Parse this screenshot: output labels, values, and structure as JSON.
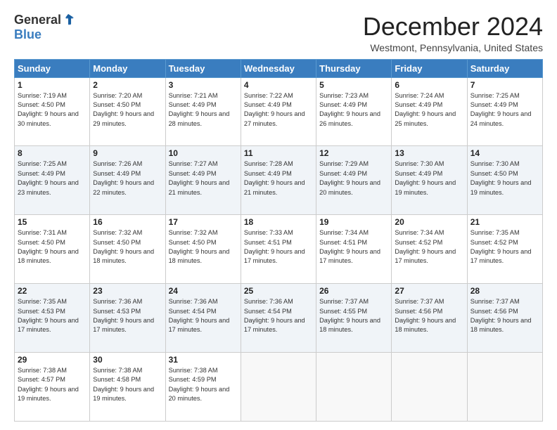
{
  "logo": {
    "general": "General",
    "blue": "Blue"
  },
  "header": {
    "month_title": "December 2024",
    "location": "Westmont, Pennsylvania, United States"
  },
  "days_of_week": [
    "Sunday",
    "Monday",
    "Tuesday",
    "Wednesday",
    "Thursday",
    "Friday",
    "Saturday"
  ],
  "weeks": [
    [
      {
        "day": "1",
        "sunrise": "7:19 AM",
        "sunset": "4:50 PM",
        "daylight": "9 hours and 30 minutes."
      },
      {
        "day": "2",
        "sunrise": "7:20 AM",
        "sunset": "4:50 PM",
        "daylight": "9 hours and 29 minutes."
      },
      {
        "day": "3",
        "sunrise": "7:21 AM",
        "sunset": "4:49 PM",
        "daylight": "9 hours and 28 minutes."
      },
      {
        "day": "4",
        "sunrise": "7:22 AM",
        "sunset": "4:49 PM",
        "daylight": "9 hours and 27 minutes."
      },
      {
        "day": "5",
        "sunrise": "7:23 AM",
        "sunset": "4:49 PM",
        "daylight": "9 hours and 26 minutes."
      },
      {
        "day": "6",
        "sunrise": "7:24 AM",
        "sunset": "4:49 PM",
        "daylight": "9 hours and 25 minutes."
      },
      {
        "day": "7",
        "sunrise": "7:25 AM",
        "sunset": "4:49 PM",
        "daylight": "9 hours and 24 minutes."
      }
    ],
    [
      {
        "day": "8",
        "sunrise": "7:25 AM",
        "sunset": "4:49 PM",
        "daylight": "9 hours and 23 minutes."
      },
      {
        "day": "9",
        "sunrise": "7:26 AM",
        "sunset": "4:49 PM",
        "daylight": "9 hours and 22 minutes."
      },
      {
        "day": "10",
        "sunrise": "7:27 AM",
        "sunset": "4:49 PM",
        "daylight": "9 hours and 21 minutes."
      },
      {
        "day": "11",
        "sunrise": "7:28 AM",
        "sunset": "4:49 PM",
        "daylight": "9 hours and 21 minutes."
      },
      {
        "day": "12",
        "sunrise": "7:29 AM",
        "sunset": "4:49 PM",
        "daylight": "9 hours and 20 minutes."
      },
      {
        "day": "13",
        "sunrise": "7:30 AM",
        "sunset": "4:49 PM",
        "daylight": "9 hours and 19 minutes."
      },
      {
        "day": "14",
        "sunrise": "7:30 AM",
        "sunset": "4:50 PM",
        "daylight": "9 hours and 19 minutes."
      }
    ],
    [
      {
        "day": "15",
        "sunrise": "7:31 AM",
        "sunset": "4:50 PM",
        "daylight": "9 hours and 18 minutes."
      },
      {
        "day": "16",
        "sunrise": "7:32 AM",
        "sunset": "4:50 PM",
        "daylight": "9 hours and 18 minutes."
      },
      {
        "day": "17",
        "sunrise": "7:32 AM",
        "sunset": "4:50 PM",
        "daylight": "9 hours and 18 minutes."
      },
      {
        "day": "18",
        "sunrise": "7:33 AM",
        "sunset": "4:51 PM",
        "daylight": "9 hours and 17 minutes."
      },
      {
        "day": "19",
        "sunrise": "7:34 AM",
        "sunset": "4:51 PM",
        "daylight": "9 hours and 17 minutes."
      },
      {
        "day": "20",
        "sunrise": "7:34 AM",
        "sunset": "4:52 PM",
        "daylight": "9 hours and 17 minutes."
      },
      {
        "day": "21",
        "sunrise": "7:35 AM",
        "sunset": "4:52 PM",
        "daylight": "9 hours and 17 minutes."
      }
    ],
    [
      {
        "day": "22",
        "sunrise": "7:35 AM",
        "sunset": "4:53 PM",
        "daylight": "9 hours and 17 minutes."
      },
      {
        "day": "23",
        "sunrise": "7:36 AM",
        "sunset": "4:53 PM",
        "daylight": "9 hours and 17 minutes."
      },
      {
        "day": "24",
        "sunrise": "7:36 AM",
        "sunset": "4:54 PM",
        "daylight": "9 hours and 17 minutes."
      },
      {
        "day": "25",
        "sunrise": "7:36 AM",
        "sunset": "4:54 PM",
        "daylight": "9 hours and 17 minutes."
      },
      {
        "day": "26",
        "sunrise": "7:37 AM",
        "sunset": "4:55 PM",
        "daylight": "9 hours and 18 minutes."
      },
      {
        "day": "27",
        "sunrise": "7:37 AM",
        "sunset": "4:56 PM",
        "daylight": "9 hours and 18 minutes."
      },
      {
        "day": "28",
        "sunrise": "7:37 AM",
        "sunset": "4:56 PM",
        "daylight": "9 hours and 18 minutes."
      }
    ],
    [
      {
        "day": "29",
        "sunrise": "7:38 AM",
        "sunset": "4:57 PM",
        "daylight": "9 hours and 19 minutes."
      },
      {
        "day": "30",
        "sunrise": "7:38 AM",
        "sunset": "4:58 PM",
        "daylight": "9 hours and 19 minutes."
      },
      {
        "day": "31",
        "sunrise": "7:38 AM",
        "sunset": "4:59 PM",
        "daylight": "9 hours and 20 minutes."
      },
      null,
      null,
      null,
      null
    ]
  ],
  "labels": {
    "sunrise": "Sunrise:",
    "sunset": "Sunset:",
    "daylight": "Daylight:"
  }
}
